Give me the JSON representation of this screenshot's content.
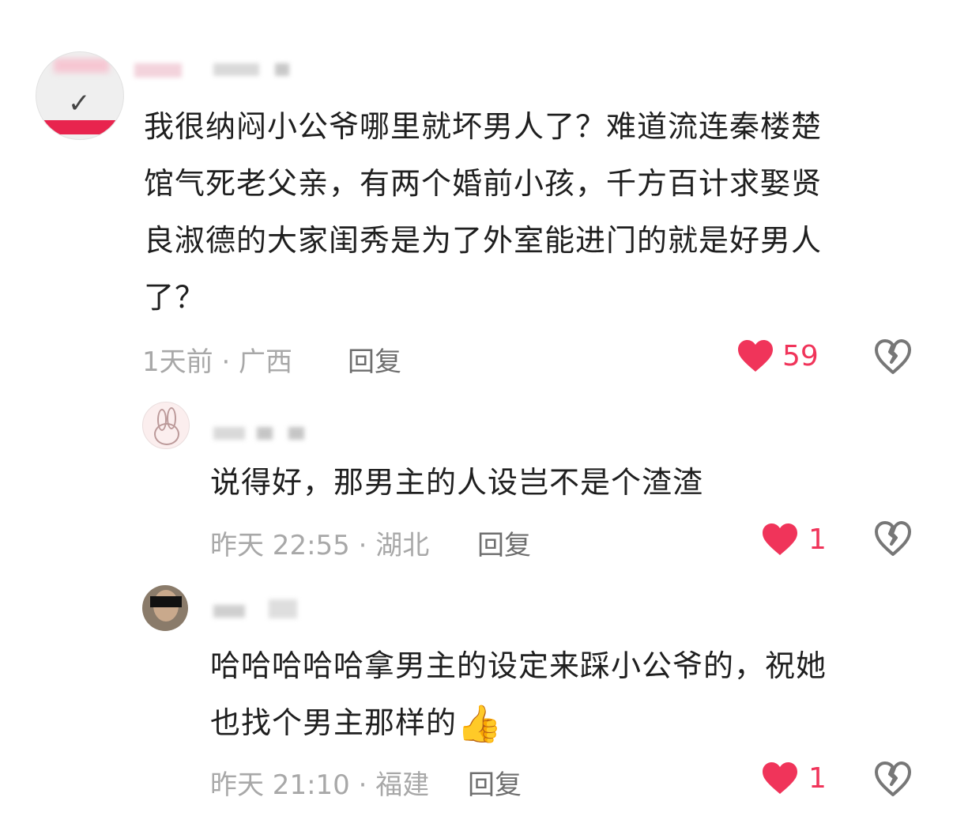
{
  "comments": [
    {
      "text": "我很纳闷小公爷哪里就坏男人了？难道流连秦楼楚馆气死老父亲，有两个婚前小孩，千方百计求娶贤良淑德的大家闺秀是为了外室能进门的就是好男人了？",
      "lines": [
        "我很纳闷小公爷哪里就坏男人了？难道流连秦楼楚",
        "馆气死老父亲，有两个婚前小孩，千方百计求娶贤",
        "良淑德的大家闺秀是为了外室能进门的就是好男人",
        "了？"
      ],
      "time": "1天前 · 广西",
      "reply_label": "回复",
      "likes": "59"
    },
    {
      "text": "说得好，那男主的人设岂不是个渣渣",
      "time": "昨天 22:55 · 湖北",
      "reply_label": "回复",
      "likes": "1"
    },
    {
      "lines": [
        "哈哈哈哈哈拿男主的设定来踩小公爷的，祝她",
        "也找个男主那样的"
      ],
      "emoji": "👍",
      "time": "昨天 21:10 · 福建",
      "reply_label": "回复",
      "likes": "1"
    }
  ],
  "icons": {
    "like": "heart-icon",
    "dislike": "broken-heart-icon",
    "like_color": "#f0345a",
    "dislike_color": "#777777"
  }
}
